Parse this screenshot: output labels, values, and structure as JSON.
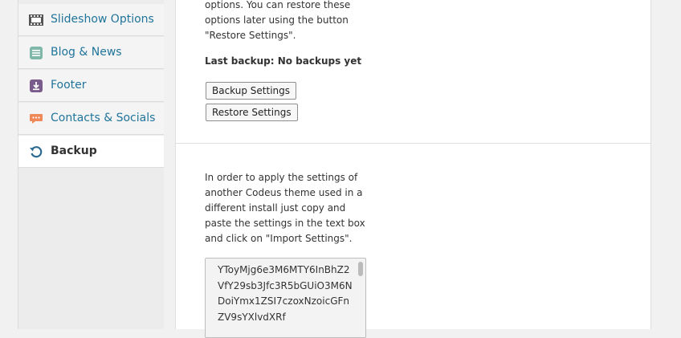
{
  "sidebar": {
    "items": [
      {
        "label": "Slideshow Options",
        "icon": "slideshow-icon",
        "active": false
      },
      {
        "label": "Blog & News",
        "icon": "blog-icon",
        "active": false
      },
      {
        "label": "Footer",
        "icon": "footer-icon",
        "active": false
      },
      {
        "label": "Contacts & Socials",
        "icon": "contacts-icon",
        "active": false
      },
      {
        "label": "Backup",
        "icon": "backup-icon",
        "active": true
      }
    ]
  },
  "backup_section": {
    "description_lines": [
      "options. You can restore these",
      "options later using the button",
      "\"Restore Settings\"."
    ],
    "last_backup": "Last backup: No backups yet",
    "backup_button": "Backup Settings",
    "restore_button": "Restore Settings"
  },
  "import_section": {
    "description_lines": [
      "In order to apply the settings of",
      "another Codeus theme used in a",
      "different install just copy and",
      "paste the settings in the text box",
      "and click on \"Import Settings\"."
    ],
    "settings_text": "YToyMjg6e3M6MTY6InBhZ2VfY29sb3Jfc3R5bGUiO3M6NDoiYmx1ZSI7czoxNzoicGFnZV9sYXlvdXRf"
  },
  "colors": {
    "link": "#21759b",
    "active_text": "#333333",
    "background": "#f1f1f1"
  }
}
